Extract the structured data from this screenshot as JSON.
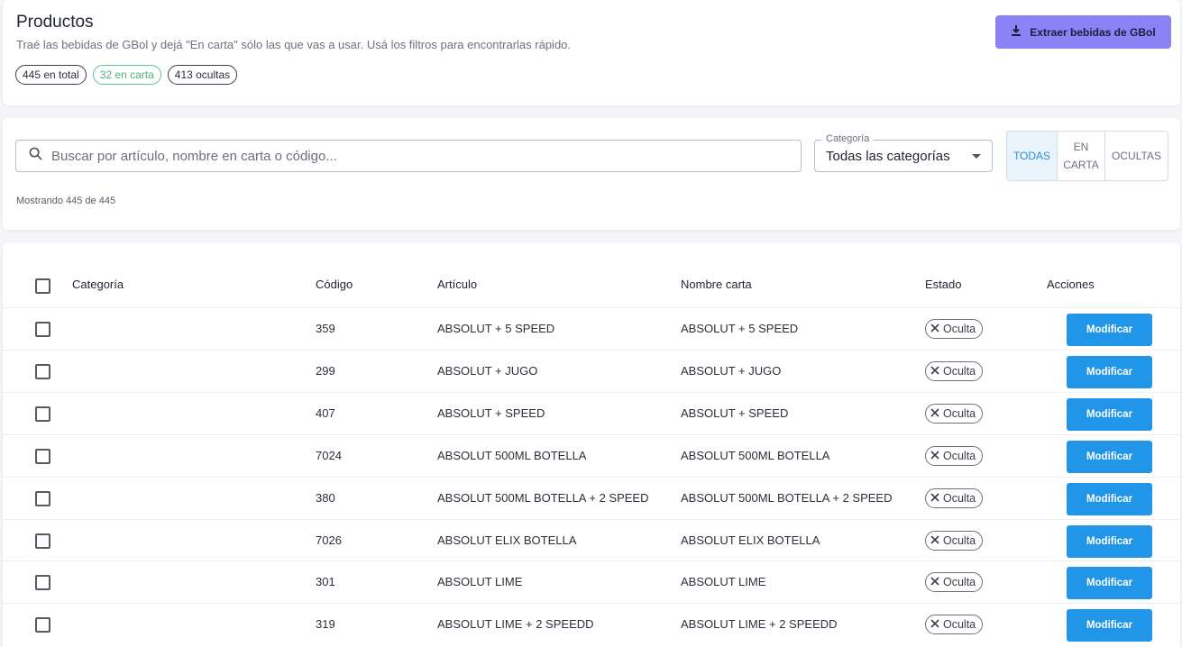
{
  "header": {
    "title": "Productos",
    "subtitle": "Traé las bebidas de GBol y dejá \"En carta\" sólo las que vas a usar. Usá los filtros para encontrarlas rápido.",
    "chips": {
      "total": "445 en total",
      "in_menu": "32 en carta",
      "hidden": "413 ocultas"
    },
    "extract_button": "Extraer bebidas de GBol",
    "accent_color": "#8b82f5"
  },
  "filters": {
    "search_placeholder": "Buscar por artículo, nombre en carta o código...",
    "category_label": "Categoría",
    "category_value": "Todas las categorías",
    "toggles": {
      "all": "TODAS",
      "in_menu": "EN CARTA",
      "hidden": "OCULTAS",
      "active": "all"
    },
    "showing": "Mostrando 445 de 445"
  },
  "table": {
    "headers": {
      "category": "Categoría",
      "code": "Código",
      "article": "Artículo",
      "menu_name": "Nombre carta",
      "status": "Estado",
      "actions": "Acciones"
    },
    "button_color": "#2196e8",
    "rows": [
      {
        "category": "",
        "code": "359",
        "article": "ABSOLUT + 5 SPEED",
        "menu_name": "ABSOLUT + 5 SPEED",
        "status": "Oculta",
        "action": "Modificar"
      },
      {
        "category": "",
        "code": "299",
        "article": "ABSOLUT + JUGO",
        "menu_name": "ABSOLUT + JUGO",
        "status": "Oculta",
        "action": "Modificar"
      },
      {
        "category": "",
        "code": "407",
        "article": "ABSOLUT + SPEED",
        "menu_name": "ABSOLUT + SPEED",
        "status": "Oculta",
        "action": "Modificar"
      },
      {
        "category": "",
        "code": "7024",
        "article": "ABSOLUT 500ML BOTELLA",
        "menu_name": "ABSOLUT 500ML BOTELLA",
        "status": "Oculta",
        "action": "Modificar"
      },
      {
        "category": "",
        "code": "380",
        "article": "ABSOLUT 500ML BOTELLA + 2 SPEED",
        "menu_name": "ABSOLUT 500ML BOTELLA + 2 SPEED",
        "status": "Oculta",
        "action": "Modificar"
      },
      {
        "category": "",
        "code": "7026",
        "article": "ABSOLUT ELIX BOTELLA",
        "menu_name": "ABSOLUT ELIX BOTELLA",
        "status": "Oculta",
        "action": "Modificar"
      },
      {
        "category": "",
        "code": "301",
        "article": "ABSOLUT LIME",
        "menu_name": "ABSOLUT LIME",
        "status": "Oculta",
        "action": "Modificar"
      },
      {
        "category": "",
        "code": "319",
        "article": "ABSOLUT LIME + 2 SPEEDD",
        "menu_name": "ABSOLUT LIME + 2 SPEEDD",
        "status": "Oculta",
        "action": "Modificar"
      }
    ]
  }
}
